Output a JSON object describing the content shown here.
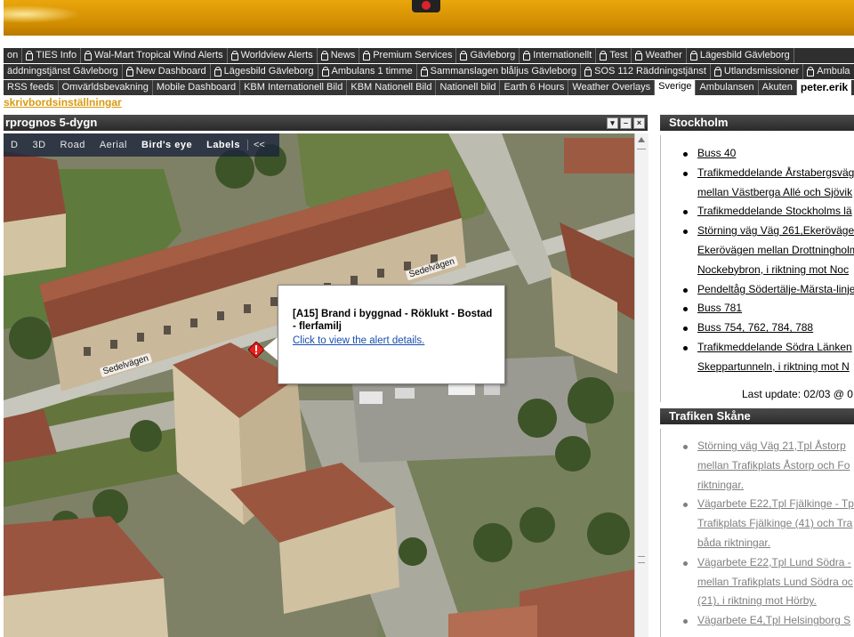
{
  "banner": {
    "logo": "logo-icon"
  },
  "tabs": {
    "row1": [
      "on",
      "TIES Info",
      "Wal-Mart Tropical Wind Alerts",
      "Worldview Alerts",
      "News",
      "Premium Services",
      "Gävleborg",
      "Internationellt",
      "Test",
      "Weather",
      "Lägesbild Gävleborg"
    ],
    "row2": [
      "äddningstjänst Gävleborg",
      "New Dashboard",
      "Lägesbild Gävleborg",
      "Ambulans 1 timme",
      "Sammanslagen blåljus Gävleborg",
      "SOS 112 Räddningstjänst",
      "Utlandsmissioner",
      "Ambula"
    ],
    "row3": [
      "RSS feeds",
      "Omvärldsbevakning",
      "Mobile Dashboard",
      "KBM Internationell Bild",
      "KBM Nationell Bild",
      "Nationell bild",
      "Earth 6 Hours",
      "Weather Overlays",
      "Sverige",
      "Ambulansen",
      "Akuten"
    ],
    "active": "Sverige",
    "user": "peter.erik"
  },
  "settings_link": "skrivbordsinställningar",
  "map": {
    "title": "rprognos 5-dygn",
    "controls": [
      "▾",
      "–",
      "×"
    ],
    "toolbar": {
      "items": [
        "D",
        "3D",
        "Road",
        "Aerial",
        "Bird's eye",
        "Labels"
      ],
      "collapse": "<<"
    },
    "streets": [
      "Sedelvägen",
      "Sedelvägen"
    ],
    "popup": {
      "title": "[A15] Brand i byggnad - Röklukt - Bostad - flerfamilj",
      "link": "Click to view the alert details."
    }
  },
  "stockholm": {
    "title": "Stockholm",
    "items": [
      {
        "lines": [
          "Buss 40"
        ]
      },
      {
        "lines": [
          "Trafikmeddelande Årstabergsväg",
          "mellan Västberga Allé och Sjövik"
        ]
      },
      {
        "lines": [
          "Trafikmeddelande Stockholms lä"
        ]
      },
      {
        "lines": [
          "Störning väg Väg 261,Ekerövägen",
          "Ekerövägen mellan Drottningholm",
          "Nockebybron, i riktning mot Noc"
        ]
      },
      {
        "lines": [
          "Pendeltåg Södertälje-Märsta-linje"
        ]
      },
      {
        "lines": [
          "Buss 781"
        ]
      },
      {
        "lines": [
          "Buss 754, 762, 784, 788"
        ]
      },
      {
        "lines": [
          "Trafikmeddelande Södra Länken",
          "Skeppartunneln, i riktning mot N"
        ]
      }
    ],
    "last_update": "Last update: 02/03 @ 0"
  },
  "skane": {
    "title": "Trafiken Skåne",
    "items": [
      {
        "lines": [
          "Störning väg Väg 21,Tpl Åstorp",
          "mellan Trafikplats Åstorp och Fo",
          "riktningar."
        ]
      },
      {
        "lines": [
          "Vägarbete E22,Tpl Fjälkinge - Tp",
          "Trafikplats Fjälkinge (41) och Tra",
          "båda riktningar."
        ]
      },
      {
        "lines": [
          "Vägarbete E22,Tpl Lund Södra -",
          "mellan Trafikplats Lund Södra oc",
          "(21), i riktning mot Hörby."
        ]
      },
      {
        "lines": [
          "Vägarbete E4,Tpl Helsingborg S"
        ]
      }
    ]
  }
}
